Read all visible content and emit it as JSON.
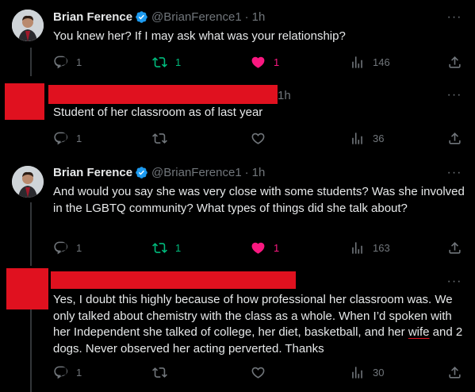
{
  "tweets": [
    {
      "name": "Brian Ference",
      "handle": "@BrianFerence1",
      "time": "1h",
      "text": "You knew her? If I may ask what was your relationship?",
      "replies": "1",
      "retweets": "1",
      "likes": "1",
      "views": "146"
    },
    {
      "time": "1h",
      "text": "Student of her classroom as of last year",
      "replies": "1",
      "retweets": "",
      "likes": "",
      "views": "36"
    },
    {
      "name": "Brian Ference",
      "handle": "@BrianFerence1",
      "time": "1h",
      "text": "And would you say she was very close with some students? Was she involved in the LGBTQ community? What types of things did she talk about?",
      "replies": "1",
      "retweets": "1",
      "likes": "1",
      "views": "163"
    },
    {
      "text_before": "Yes, I doubt this highly because of how professional her classroom was. We only talked about chemistry with the class as a whole. When I’d spoken with her Independent she talked of college, her diet, basketball, and her ",
      "text_underlined": "wife",
      "text_after": " and 2 dogs. Never observed her acting perverted. Thanks",
      "replies": "1",
      "retweets": "",
      "likes": "",
      "views": "30"
    }
  ],
  "more_label": "···",
  "dot": "·",
  "colors": {
    "background": "#000000",
    "text": "#e7e9ea",
    "muted": "#71767b",
    "retweet_active": "#00ba7c",
    "like_active": "#f91880",
    "verified": "#1d9bf0",
    "redaction": "#e0111f"
  },
  "icons": {
    "reply": "reply-icon",
    "retweet": "retweet-icon",
    "like": "heart-icon",
    "views": "views-icon",
    "share": "share-icon",
    "verified": "verified-badge-icon"
  }
}
